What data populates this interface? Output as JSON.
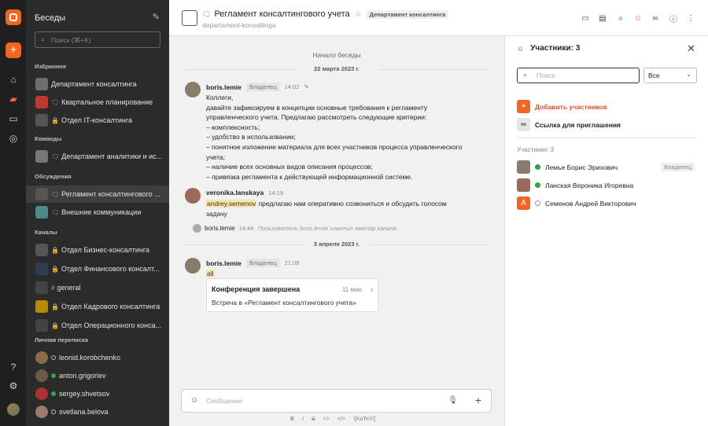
{
  "sidebar": {
    "title": "Беседы",
    "search_placeholder": "Поиск (⌘+K)",
    "sections": {
      "favorites": "Избранное",
      "teams": "Команды",
      "discussions": "Обсуждения",
      "channels": "Каналы",
      "personal": "Личная переписка"
    },
    "favorites": [
      {
        "label": "Департамент консалтинга",
        "glyph": "",
        "color": "#6d6d6d"
      },
      {
        "label": "Квартальное планирование",
        "glyph": "🗨",
        "color": "#c0392b"
      },
      {
        "label": "Отдел IT-консалтинга",
        "glyph": "🔒",
        "color": "#555"
      }
    ],
    "teams": [
      {
        "label": "Департамент аналитики и ис...",
        "glyph": "🗨",
        "color": "#777"
      }
    ],
    "discussions": [
      {
        "label": "Регламент консалтингового ...",
        "glyph": "🗨",
        "color": "#555"
      },
      {
        "label": "Внешние коммуникации",
        "glyph": "🗨",
        "color": "#4a8a8a"
      }
    ],
    "channels": [
      {
        "label": "Отдел Бизнес-консалтинга",
        "glyph": "🔒",
        "color": "#555"
      },
      {
        "label": "Отдел Финансового консалт...",
        "glyph": "🔒",
        "color": "#2c3e50"
      },
      {
        "label": "general",
        "glyph": "#",
        "color": "#444"
      },
      {
        "label": "Отдел Кадрового консалтинга",
        "glyph": "🔒",
        "color": "#b58b00"
      },
      {
        "label": "Отдел Операционного конса...",
        "glyph": "🔒",
        "color": "#444"
      }
    ],
    "personal": [
      {
        "label": "leonid.korobchenko",
        "status": "offline",
        "color": "#8a6a4a"
      },
      {
        "label": "anton.grigoriev",
        "status": "online",
        "color": "#6a5a4a"
      },
      {
        "label": "sergey.shvetsov",
        "status": "online",
        "color": "#b03030"
      },
      {
        "label": "svetlana.belova",
        "status": "offline",
        "color": "#9a7a6a"
      }
    ]
  },
  "header": {
    "title": "Регламент консалтингового учета",
    "tag": "Департамент консалтинга",
    "subtitle": "departament-konsaltinga"
  },
  "chat": {
    "start": "Начало беседы",
    "date1": "22 марта 2023 г.",
    "date2": "3 апреля 2023 г.",
    "m1": {
      "name": "boris.lemie",
      "role": "Владелец",
      "time": "14:02",
      "lines": [
        "Коллеги,",
        "давайте зафиксируем в концепции основные требования к регламенту",
        "управленческого учета. Предлагаю рассмотреть следующие критерии:",
        "– комплексность;",
        "– удобство в использовании;",
        "– понятное изложение материала для всех участников процесса управленческого",
        "учета;",
        "– наличие всех основных видов описания процессов;",
        "– привязка регламента к действующей информационной системе."
      ]
    },
    "m2": {
      "name": "veronika.lanskaya",
      "time": "14:19",
      "mention": "andrey.semenov",
      "text_a": " предлагаю нам оперативно созвониться и обсудить голосом",
      "text_b": "задачу"
    },
    "sys": {
      "name": "boris.lemie",
      "time": "14:44",
      "text": "Пользователь boris.lemie изменил аватар канала"
    },
    "m3": {
      "name": "boris.lemie",
      "role": "Владелец",
      "time": "21:08",
      "mention": "all"
    },
    "card": {
      "title": "Конференция завершена",
      "duration": "11 мин.",
      "subtitle": "Встреча в «Регламент консалтингового учета»"
    }
  },
  "composer": {
    "placeholder": "Сообщение",
    "format": [
      "B",
      "I",
      "S",
      "<>",
      "</>",
      "\\[KaTeX\\]"
    ]
  },
  "panel": {
    "title": "Участники: 3",
    "search_placeholder": "Поиск",
    "filter": "Все",
    "add": "Добавить участников",
    "invite": "Ссылка для приглашения",
    "label": "Участники: 3",
    "members": [
      {
        "name": "Лемье Борис Эрихович",
        "status": "online",
        "role": "Владелец",
        "color": "#8a7a6a",
        "initial": ""
      },
      {
        "name": "Ланская Вероника Игоревна",
        "status": "online",
        "role": "",
        "color": "#9a6a5a",
        "initial": ""
      },
      {
        "name": "Семенов Андрей Викторович",
        "status": "offline",
        "role": "",
        "color": "#f26522",
        "initial": "A"
      }
    ]
  },
  "colors": {
    "accent": "#f26522",
    "online": "#2ea44f"
  }
}
